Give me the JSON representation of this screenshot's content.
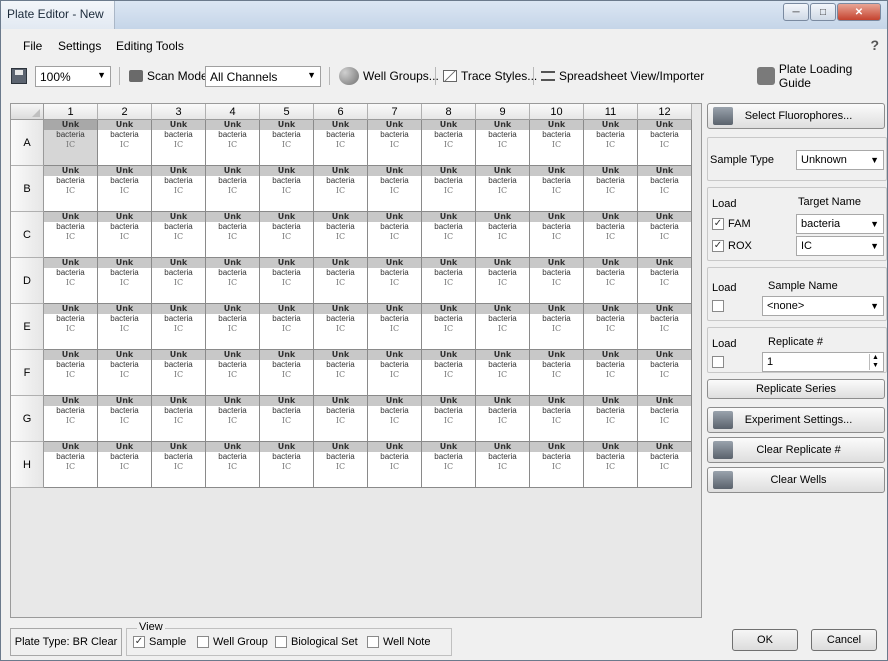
{
  "window": {
    "title": "Plate Editor - New"
  },
  "menu": {
    "file": "File",
    "settings": "Settings",
    "editing_tools": "Editing Tools",
    "help": "?"
  },
  "toolbar": {
    "zoom": "100%",
    "scan_mode_label": "Scan Mode",
    "channels": "All Channels",
    "well_groups": "Well Groups...",
    "trace_styles": "Trace Styles...",
    "spreadsheet": "Spreadsheet View/Importer",
    "plate_loading_guide": "Plate Loading Guide"
  },
  "plate": {
    "columns": [
      "1",
      "2",
      "3",
      "4",
      "5",
      "6",
      "7",
      "8",
      "9",
      "10",
      "11",
      "12"
    ],
    "rows": [
      "A",
      "B",
      "C",
      "D",
      "E",
      "F",
      "G",
      "H"
    ],
    "well": {
      "type": "Unk",
      "target1": "bacteria",
      "target2": "IC"
    },
    "selected_well": "A1"
  },
  "panel": {
    "select_fluorophores": "Select Fluorophores...",
    "sample_type_label": "Sample Type",
    "sample_type_value": "Unknown",
    "load_label": "Load",
    "target_name_label": "Target Name",
    "targets": [
      {
        "fluor": "FAM",
        "checked": true,
        "name": "bacteria"
      },
      {
        "fluor": "ROX",
        "checked": true,
        "name": "IC"
      }
    ],
    "sample_name_label": "Sample Name",
    "sample_name_value": "<none>",
    "replicate_label": "Replicate #",
    "replicate_value": "1",
    "replicate_series": "Replicate Series",
    "experiment_settings": "Experiment Settings...",
    "clear_replicate": "Clear Replicate #",
    "clear_wells": "Clear Wells"
  },
  "status": {
    "plate_type": "Plate Type: BR Clear",
    "view_label": "View",
    "view_sample": "Sample",
    "view_well_group": "Well Group",
    "view_biological_set": "Biological Set",
    "view_well_note": "Well Note",
    "ok": "OK",
    "cancel": "Cancel"
  }
}
